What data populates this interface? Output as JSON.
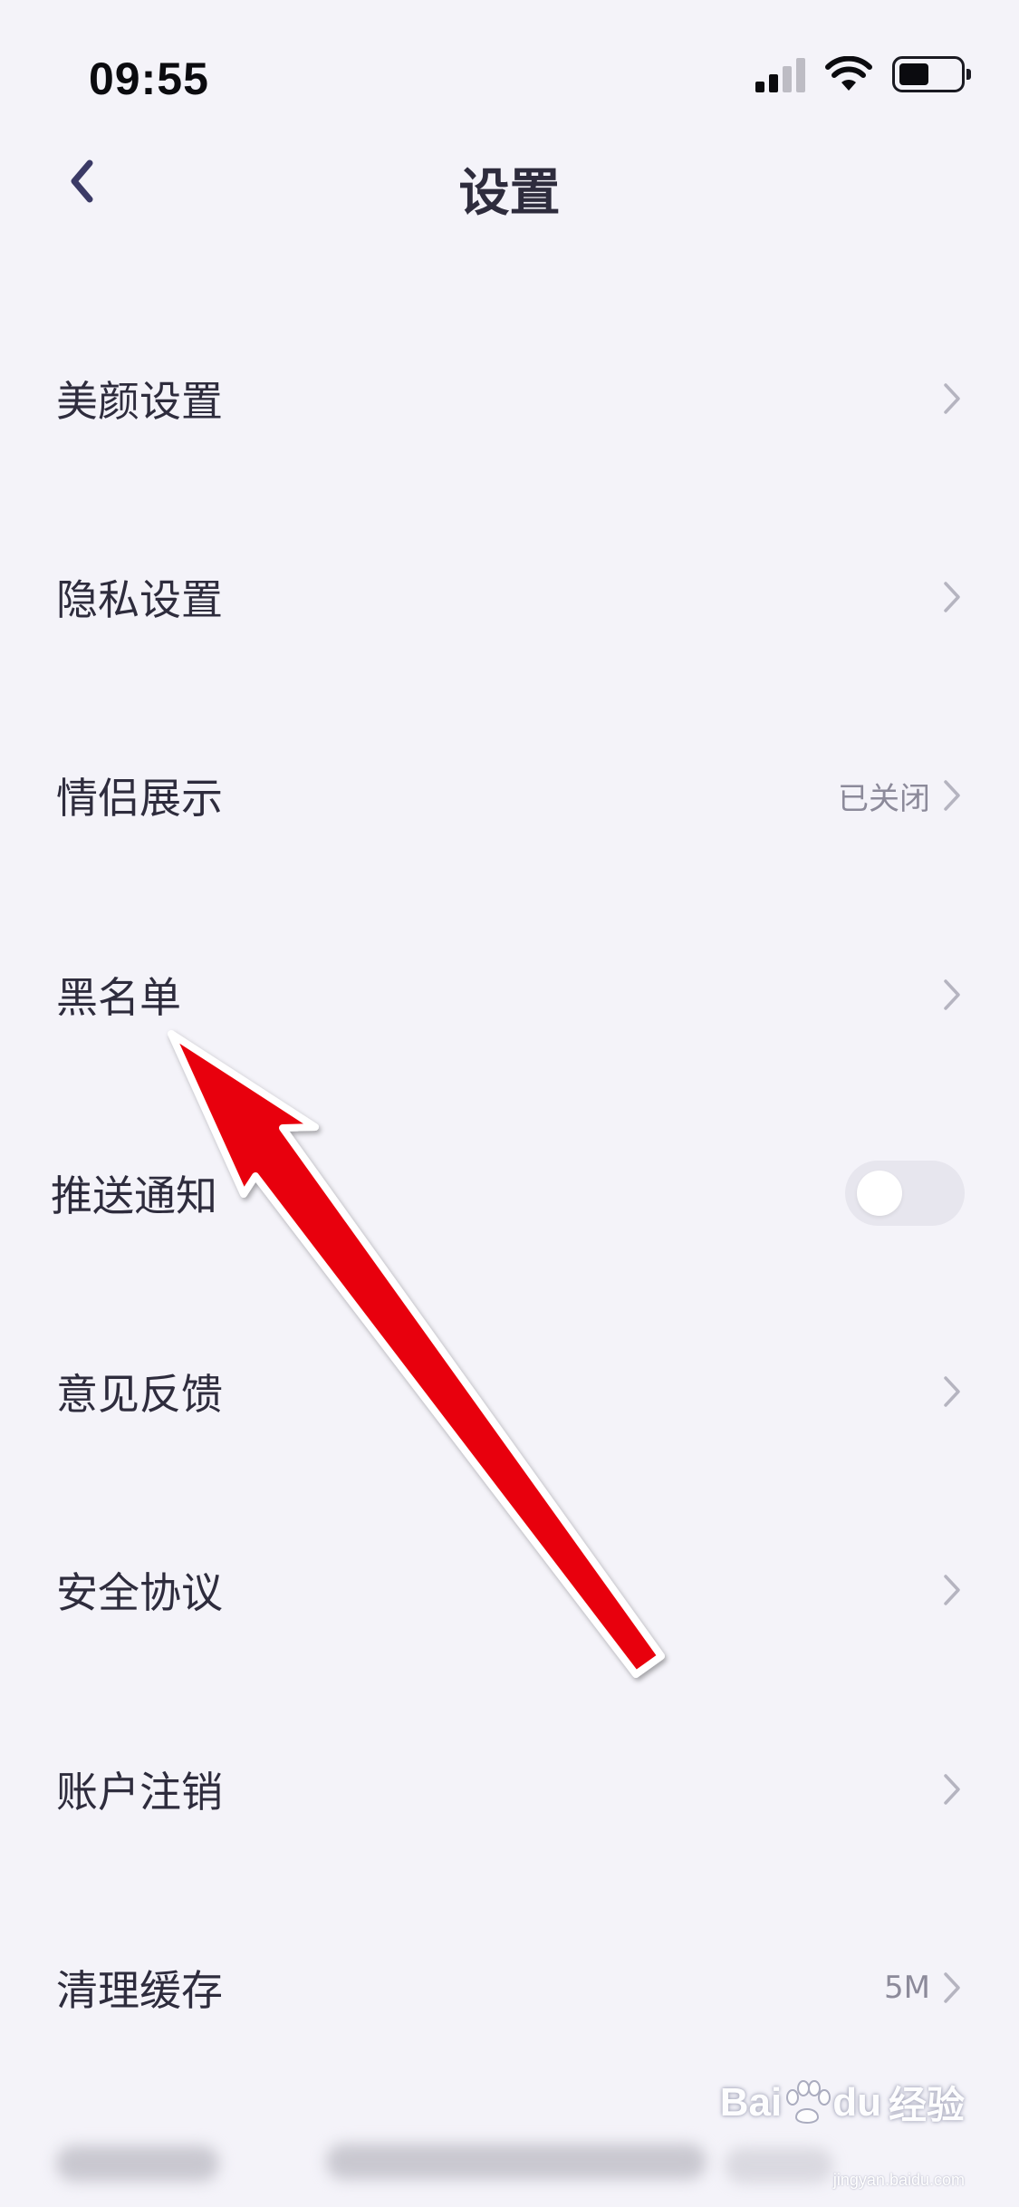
{
  "status_bar": {
    "time": "09:55",
    "icons": [
      "cellular-signal-icon",
      "wifi-icon",
      "battery-icon"
    ]
  },
  "header": {
    "title": "设置",
    "back_icon": "chevron-left-icon"
  },
  "settings": [
    {
      "label": "美颜设置",
      "value": "",
      "control": "chevron"
    },
    {
      "label": "隐私设置",
      "value": "",
      "control": "chevron"
    },
    {
      "label": "情侣展示",
      "value": "已关闭",
      "control": "chevron"
    },
    {
      "label": "黑名单",
      "value": "",
      "control": "chevron"
    },
    {
      "label": "推送通知",
      "value": "",
      "control": "toggle",
      "toggle_on": false
    },
    {
      "label": "意见反馈",
      "value": "",
      "control": "chevron"
    },
    {
      "label": "安全协议",
      "value": "",
      "control": "chevron"
    },
    {
      "label": "账户注销",
      "value": "",
      "control": "chevron"
    },
    {
      "label": "清理缓存",
      "value": "5M",
      "control": "chevron"
    }
  ],
  "annotation": {
    "type": "arrow",
    "color": "#e8060c",
    "points_to": "黑名单"
  },
  "watermark": {
    "logo": "Bai",
    "logo_suffix": "du",
    "text": "经验",
    "url": "jingyan.baidu.com"
  },
  "colors": {
    "background": "#f4f3f9",
    "text": "#2e2c3d",
    "secondary_text": "#8c8a9a",
    "chevron": "#b5b4c0",
    "toggle_off": "#e7e6ee"
  }
}
